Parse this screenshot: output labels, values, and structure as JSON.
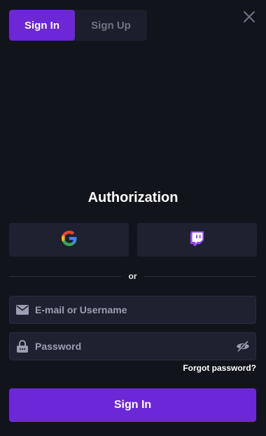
{
  "tabs": [
    {
      "label": "Sign In",
      "active": true
    },
    {
      "label": "Sign Up",
      "active": false
    }
  ],
  "close_icon": "close-icon",
  "title": "Authorization",
  "social": [
    {
      "name": "google",
      "icon": "google-icon"
    },
    {
      "name": "twitch",
      "icon": "twitch-icon"
    }
  ],
  "divider_text": "or",
  "email": {
    "placeholder": "E-mail or Username",
    "value": "",
    "icon": "envelope-icon"
  },
  "password": {
    "placeholder": "Password",
    "value": "",
    "icon": "lock-icon",
    "toggle_icon": "eye-off-icon"
  },
  "forgot_label": "Forgot password?",
  "submit_label": "Sign In",
  "colors": {
    "background": "#12141c",
    "accent": "#6c27d6",
    "surface": "#1e2130",
    "muted_text": "#6e7487"
  }
}
